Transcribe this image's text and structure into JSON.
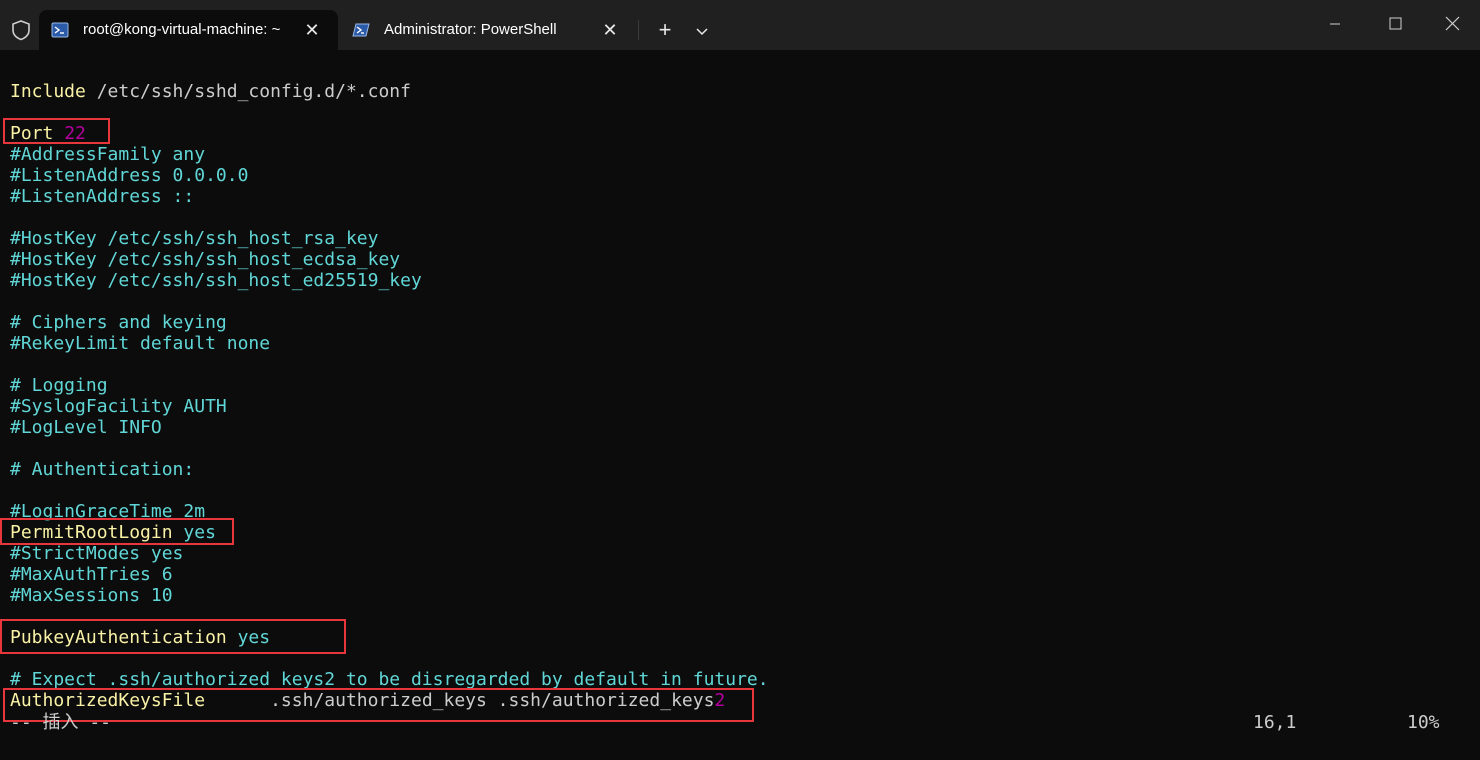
{
  "tabs": [
    {
      "title": "root@kong-virtual-machine: ~",
      "icon": "terminal-icon",
      "active": true
    },
    {
      "title": "Administrator: PowerShell",
      "icon": "powershell-icon",
      "active": false
    }
  ],
  "tabbar": {
    "new_tab": "+",
    "close_glyph": "✕"
  },
  "colors": {
    "keyword": "#f9f1a5",
    "comment": "#61d6d6",
    "number": "#b4009e",
    "plain": "#cccccc",
    "highlight_box": "#e8363d",
    "background": "#0c0c0c"
  },
  "lines": {
    "l1": {
      "kw": "Include",
      "rest": " /etc/ssh/sshd_config.d/*.conf"
    },
    "l2": {
      "kw": "Port",
      "num": "22"
    },
    "l3": "#AddressFamily any",
    "l4": "#ListenAddress 0.0.0.0",
    "l5": "#ListenAddress ::",
    "l6": "#HostKey /etc/ssh/ssh_host_rsa_key",
    "l7": "#HostKey /etc/ssh/ssh_host_ecdsa_key",
    "l8": "#HostKey /etc/ssh/ssh_host_ed25519_key",
    "l9": "# Ciphers and keying",
    "l10": "#RekeyLimit default none",
    "l11": "# Logging",
    "l12": "#SyslogFacility AUTH",
    "l13": "#LogLevel INFO",
    "l14": "# Authentication:",
    "l15": "#LoginGraceTime 2m",
    "l16": {
      "kw": "PermitRootLogin",
      "val": "yes"
    },
    "l17": "#StrictModes yes",
    "l18": "#MaxAuthTries 6",
    "l19": "#MaxSessions 10",
    "l20": {
      "kw": "PubkeyAuthentication",
      "val": "yes"
    },
    "l21": "# Expect .ssh/authorized_keys2 to be disregarded by default in future.",
    "l22": {
      "kw": "AuthorizedKeysFile",
      "rest": "      .ssh/authorized_keys .ssh/authorized_keys",
      "num": "2"
    }
  },
  "status": {
    "mode": "-- 插入 --",
    "position": "16,1",
    "percent": "10%"
  }
}
